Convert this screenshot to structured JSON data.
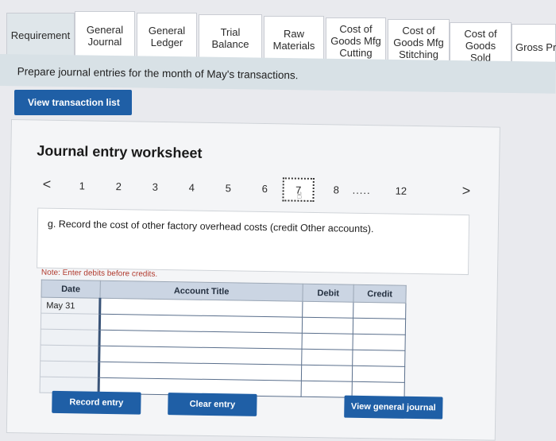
{
  "tabs": [
    {
      "label": "Requirement"
    },
    {
      "label": "General Journal"
    },
    {
      "label": "General Ledger"
    },
    {
      "label": "Trial Balance"
    },
    {
      "label": "Raw Materials"
    },
    {
      "label": "Cost of Goods Mfg Cutting"
    },
    {
      "label": "Cost of Goods Mfg Stitching"
    },
    {
      "label": "Cost of Goods Sold"
    },
    {
      "label": "Gross Pro"
    }
  ],
  "instruction": "Prepare journal entries for the month of May's transactions.",
  "view_transaction_list_label": "View transaction list",
  "worksheet": {
    "title": "Journal entry worksheet",
    "pager": {
      "prev": "<",
      "next": ">",
      "pages": [
        "1",
        "2",
        "3",
        "4",
        "5",
        "6",
        "7",
        "8",
        ".....",
        "12"
      ],
      "current": "7"
    },
    "description": "g. Record the cost of other factory overhead costs (credit Other accounts).",
    "note": "Note: Enter debits before credits.",
    "table": {
      "headers": {
        "date": "Date",
        "account": "Account Title",
        "debit": "Debit",
        "credit": "Credit"
      },
      "rows": [
        {
          "date": "May 31",
          "account": "",
          "debit": "",
          "credit": ""
        },
        {
          "date": "",
          "account": "",
          "debit": "",
          "credit": ""
        },
        {
          "date": "",
          "account": "",
          "debit": "",
          "credit": ""
        },
        {
          "date": "",
          "account": "",
          "debit": "",
          "credit": ""
        },
        {
          "date": "",
          "account": "",
          "debit": "",
          "credit": ""
        },
        {
          "date": "",
          "account": "",
          "debit": "",
          "credit": ""
        }
      ]
    },
    "buttons": {
      "record_entry": "Record entry",
      "clear_entry": "Clear entry",
      "view_general_journal": "View general journal"
    }
  },
  "colors": {
    "primary_button": "#1f5fa6",
    "instruction_bar": "#d8e1e6",
    "table_header": "#cbd5e3"
  }
}
